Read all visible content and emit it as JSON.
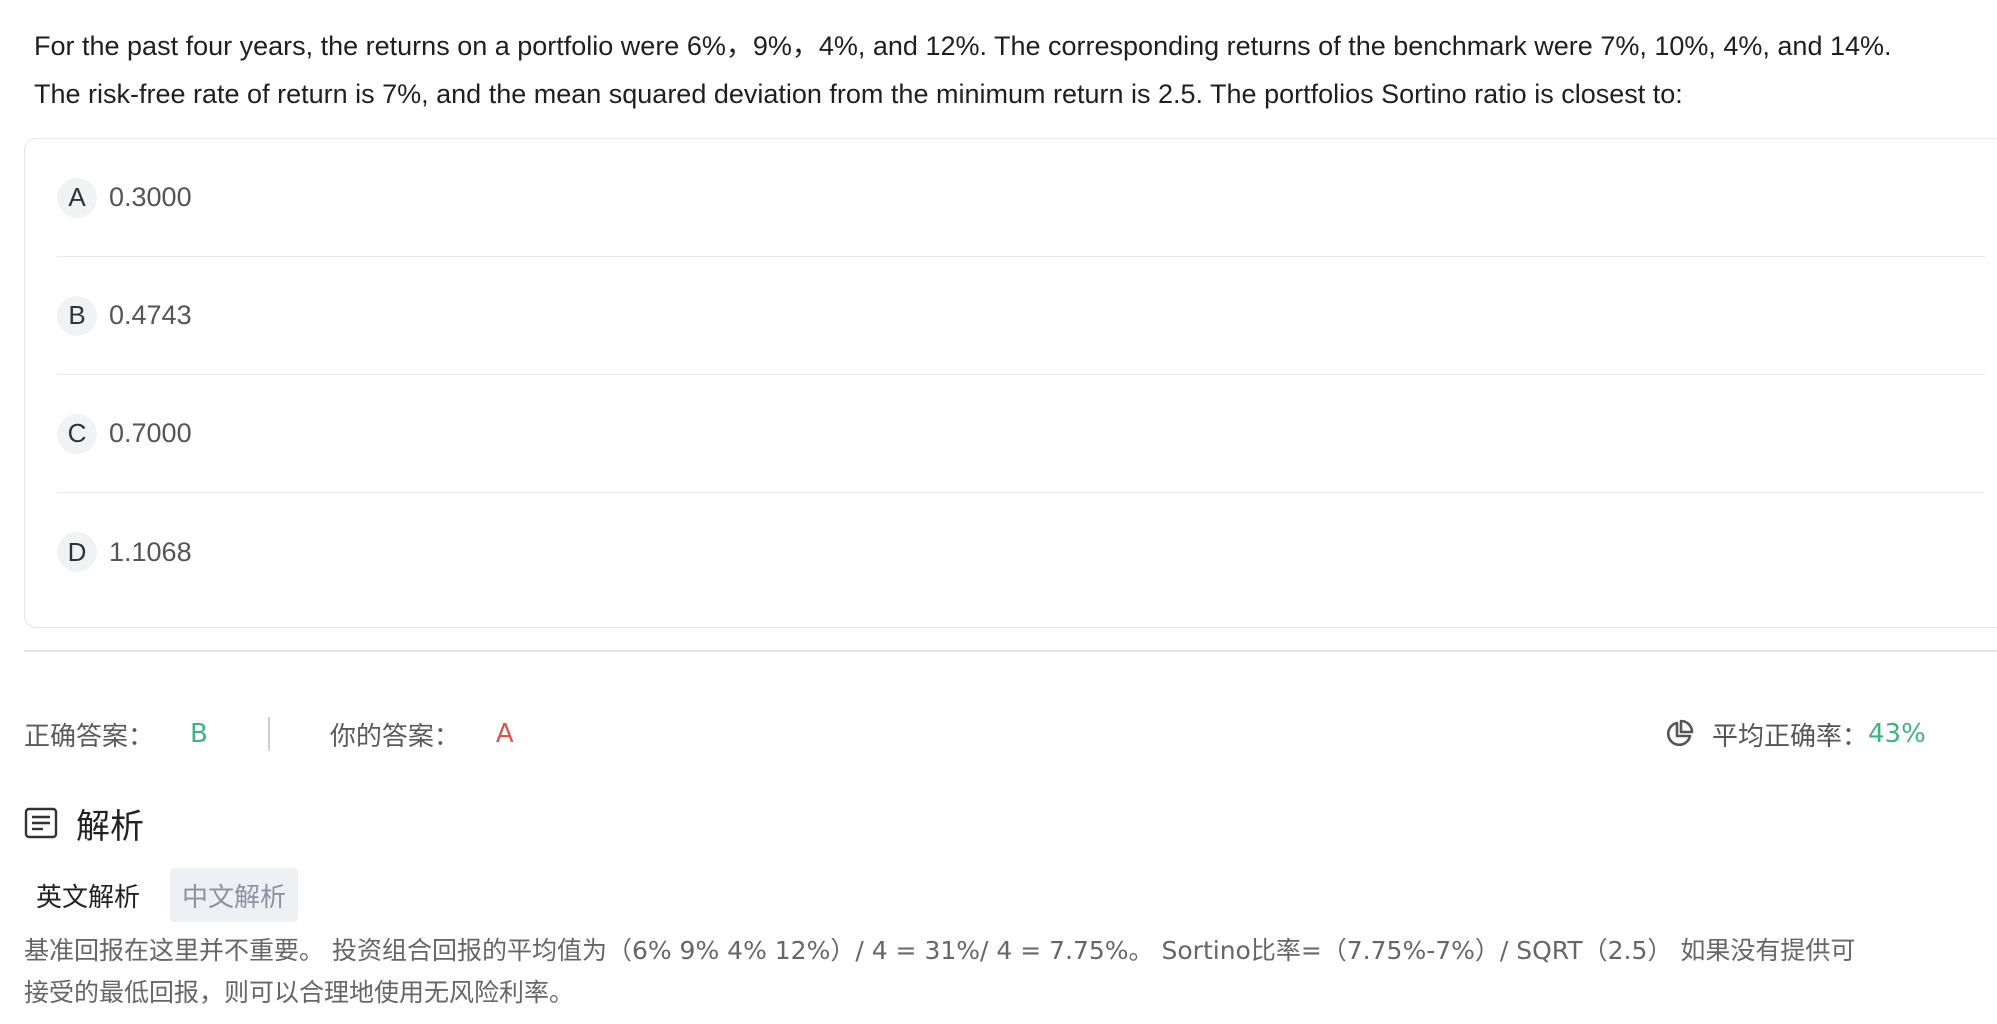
{
  "question": {
    "line1": "For the past four years, the returns on a portfolio were 6%，9%，4%, and 12%. The corresponding returns of the benchmark were 7%, 10%, 4%, and 14%.",
    "line2": "The risk-free rate of return is 7%, and the mean squared deviation from the minimum return is 2.5. The portfolios Sortino ratio is closest to:"
  },
  "options": [
    {
      "letter": "A",
      "value": "0.3000"
    },
    {
      "letter": "B",
      "value": "0.4743"
    },
    {
      "letter": "C",
      "value": "0.7000"
    },
    {
      "letter": "D",
      "value": "1.1068"
    }
  ],
  "answer_row": {
    "correct_label": "正确答案：",
    "correct_value": "B",
    "mine_label": "你的答案：",
    "mine_value": "A",
    "accuracy_label": "平均正确率：",
    "accuracy_value": "43%"
  },
  "analysis": {
    "title": "解析",
    "tab_en": "英文解析",
    "tab_zh": "中文解析",
    "line1": "基准回报在这里并不重要。 投资组合回报的平均值为（6% 9% 4% 12%）/ 4 = 31%/ 4 = 7.75%。 Sortino比率=（7.75%-7%）/ SQRT（2.5） 如果没有提供可",
    "line2": "接受的最低回报，则可以合理地使用无风险利率。"
  },
  "colors": {
    "correct": "#3fb27f",
    "wrong": "#d9534f",
    "tab_active_bg": "#eef0f3"
  },
  "icons": {
    "accuracy": "pie-chart-icon",
    "analysis": "document-lines-icon"
  }
}
